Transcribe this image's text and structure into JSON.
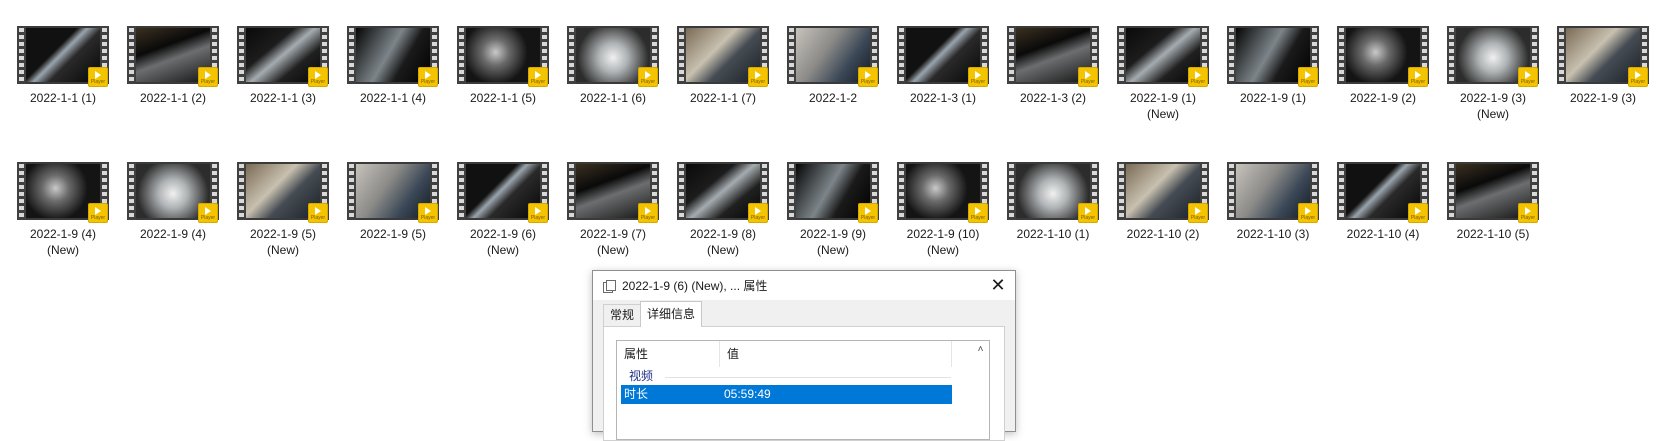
{
  "files_row1": [
    {
      "caption": "2022-1-1 (1)",
      "badge": "Player"
    },
    {
      "caption": "2022-1-1 (2)",
      "badge": "Player"
    },
    {
      "caption": "2022-1-1 (3)",
      "badge": "Player"
    },
    {
      "caption": "2022-1-1 (4)",
      "badge": "Player"
    },
    {
      "caption": "2022-1-1 (5)",
      "badge": "Player"
    },
    {
      "caption": "2022-1-1 (6)",
      "badge": "Player"
    },
    {
      "caption": "2022-1-1 (7)",
      "badge": "Player"
    },
    {
      "caption": "2022-1-2",
      "badge": "Player"
    },
    {
      "caption": "2022-1-3 (1)",
      "badge": "Player"
    },
    {
      "caption": "2022-1-3 (2)",
      "badge": "Player"
    },
    {
      "caption": "2022-1-9 (1)\n(New)",
      "badge": "Player"
    },
    {
      "caption": "2022-1-9 (1)",
      "badge": "Player"
    },
    {
      "caption": "2022-1-9 (2)",
      "badge": "Player"
    },
    {
      "caption": "2022-1-9 (3)\n(New)",
      "badge": "Player"
    },
    {
      "caption": "2022-1-9 (3)",
      "badge": "Player"
    }
  ],
  "files_row2": [
    {
      "caption": "2022-1-9 (4)\n(New)",
      "badge": "Player"
    },
    {
      "caption": "2022-1-9 (4)",
      "badge": "Player"
    },
    {
      "caption": "2022-1-9 (5)\n(New)",
      "badge": "Player"
    },
    {
      "caption": "2022-1-9 (5)",
      "badge": "Player"
    },
    {
      "caption": "2022-1-9 (6)\n(New)",
      "badge": "Player"
    },
    {
      "caption": "2022-1-9 (7)\n(New)",
      "badge": "Player"
    },
    {
      "caption": "2022-1-9 (8)\n(New)",
      "badge": "Player"
    },
    {
      "caption": "2022-1-9 (9)\n(New)",
      "badge": "Player"
    },
    {
      "caption": "2022-1-9 (10)\n(New)",
      "badge": "Player"
    },
    {
      "caption": "2022-1-10 (1)",
      "badge": "Player"
    },
    {
      "caption": "2022-1-10 (2)",
      "badge": "Player"
    },
    {
      "caption": "2022-1-10 (3)",
      "badge": "Player"
    },
    {
      "caption": "2022-1-10 (4)",
      "badge": "Player"
    },
    {
      "caption": "2022-1-10 (5)",
      "badge": "Player"
    }
  ],
  "dialog": {
    "title": "2022-1-9 (6) (New), ... 属性",
    "close": "✕",
    "tabs": [
      "常规",
      "详细信息"
    ],
    "active_tab": "详细信息",
    "columns": {
      "property": "属性",
      "value": "值"
    },
    "group": "视频",
    "rows": [
      {
        "property": "时长",
        "value": "05:59:49",
        "selected": true
      }
    ],
    "scroll_up": "˄"
  },
  "colors": {
    "selection": "#0078d7",
    "player_badge": "#f5c400",
    "group_header": "#1e3287"
  },
  "icons": {
    "badge_icon": "play-icon",
    "dialog_icon": "properties-icon",
    "close_icon": "close-icon"
  }
}
